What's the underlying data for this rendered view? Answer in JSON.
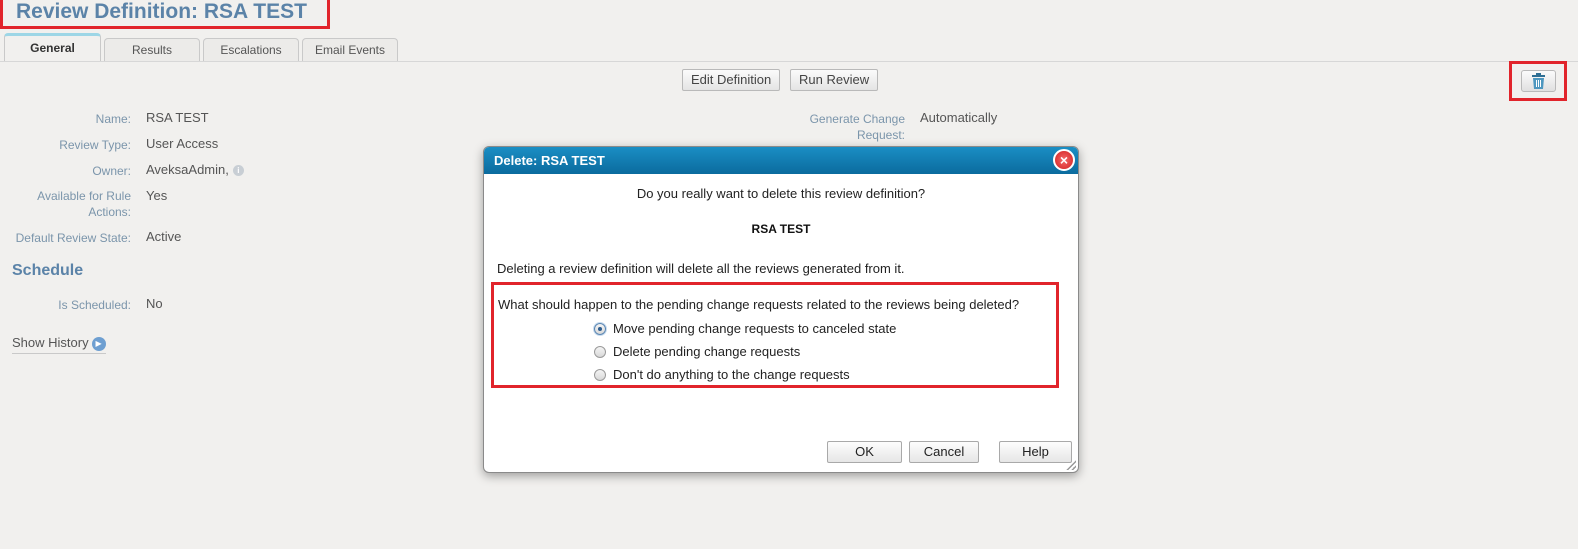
{
  "page": {
    "title": "Review Definition: RSA TEST"
  },
  "tabs": [
    {
      "label": "General"
    },
    {
      "label": "Results"
    },
    {
      "label": "Escalations"
    },
    {
      "label": "Email Events"
    }
  ],
  "toolbar": {
    "edit_label": "Edit Definition",
    "run_label": "Run Review",
    "delete_icon": "trash-icon"
  },
  "fields_left": [
    {
      "label": "Name:",
      "value": "RSA TEST"
    },
    {
      "label": "Review Type:",
      "value": "User Access"
    },
    {
      "label": "Owner:",
      "value": "AveksaAdmin,"
    },
    {
      "label": "Available for Rule Actions:",
      "value": "Yes"
    },
    {
      "label": "Default Review State:",
      "value": "Active"
    }
  ],
  "fields_right": [
    {
      "label": "Generate Change Request:",
      "value": "Automatically"
    }
  ],
  "schedule": {
    "heading": "Schedule",
    "label": "Is Scheduled:",
    "value": "No"
  },
  "show_history": "Show History",
  "dialog": {
    "title": "Delete: RSA TEST",
    "question": "Do you really want to delete this review definition?",
    "name": "RSA TEST",
    "warning": "Deleting a review definition will delete all the reviews generated from it.",
    "options_question": "What should happen to the pending change requests related to the reviews being deleted?",
    "options": [
      {
        "label": "Move pending change requests to canceled state",
        "selected": true
      },
      {
        "label": "Delete pending change requests",
        "selected": false
      },
      {
        "label": "Don't do anything to the change requests",
        "selected": false
      }
    ],
    "ok_label": "OK",
    "cancel_label": "Cancel",
    "help_label": "Help"
  },
  "colors": {
    "accent": "#5b83a8",
    "highlight": "#e1242b",
    "dialog_header": "#0b6b9e",
    "background": "#f1f0ee"
  }
}
